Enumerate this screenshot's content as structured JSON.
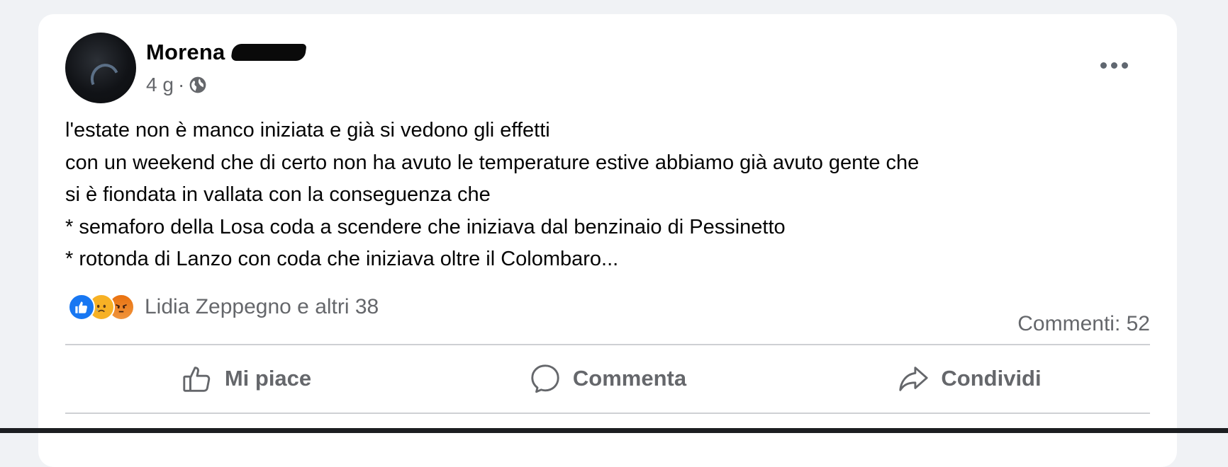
{
  "post": {
    "author": "Morena",
    "time": "4 g",
    "separator": "·",
    "lines": [
      "l'estate non è manco iniziata e già si vedono gli effetti",
      "con un weekend che di certo non ha avuto le temperature estive abbiamo già avuto gente che",
      "si è fiondata in vallata con la conseguenza che",
      "* semaforo della Losa coda a scendere che iniziava dal benzinaio di Pessinetto",
      "* rotonda di Lanzo con coda che iniziava oltre il Colombaro..."
    ],
    "reactions_summary": "Lidia Zeppegno e altri 38",
    "comments": "Commenti: 52"
  },
  "reactions": [
    "like-icon",
    "sad-icon",
    "angry-icon"
  ],
  "actions": {
    "like": "Mi piace",
    "comment": "Commenta",
    "share": "Condividi"
  },
  "colors": {
    "background": "#f0f2f5",
    "card": "#ffffff",
    "secondary_text": "#65676b",
    "like_blue": "#1877f2"
  }
}
